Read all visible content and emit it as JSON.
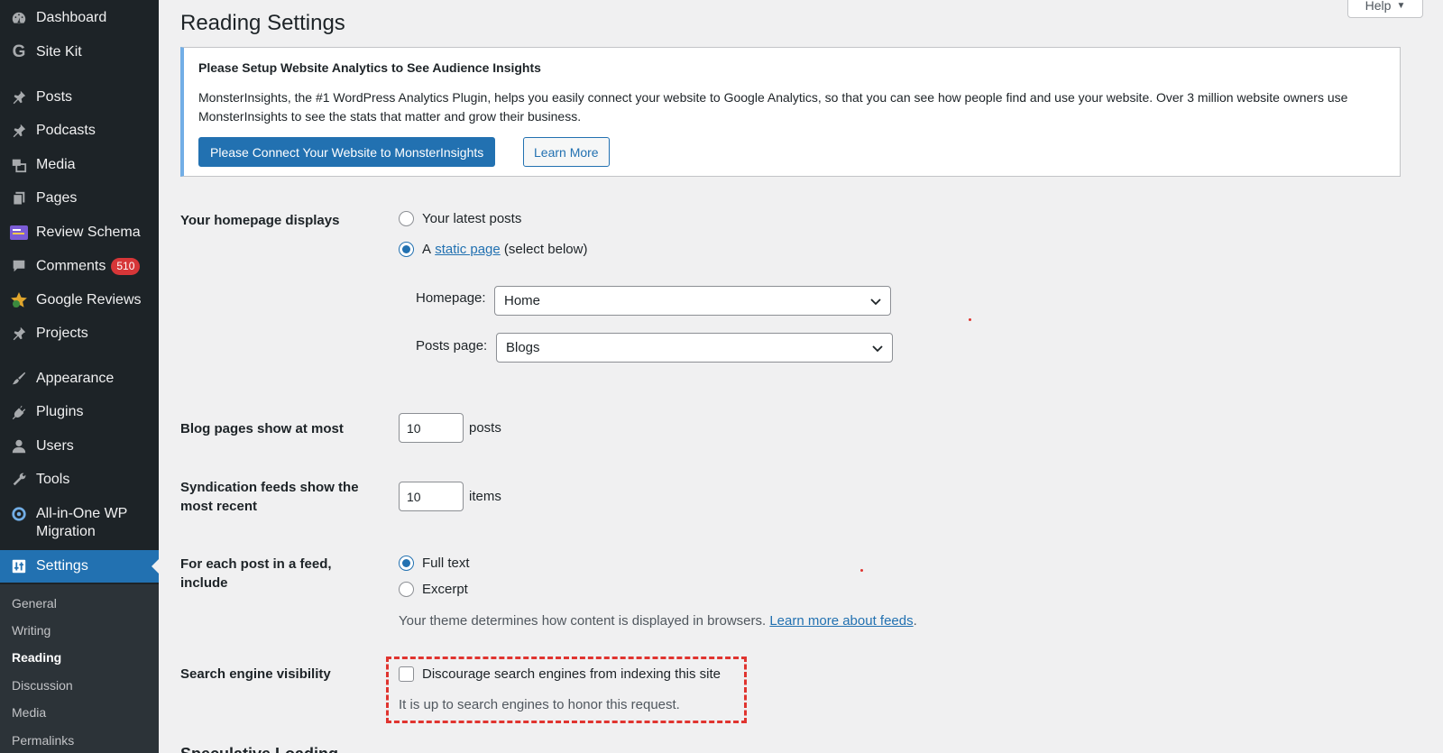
{
  "sidebar": {
    "items": [
      {
        "label": "Dashboard",
        "icon": "dashboard-icon"
      },
      {
        "label": "Site Kit",
        "icon": "google-g-icon"
      },
      {
        "label": "Posts",
        "icon": "pin-icon"
      },
      {
        "label": "Podcasts",
        "icon": "pin-icon"
      },
      {
        "label": "Media",
        "icon": "media-icon"
      },
      {
        "label": "Pages",
        "icon": "pages-icon"
      },
      {
        "label": "Review Schema",
        "icon": "review-schema-icon"
      },
      {
        "label": "Comments",
        "icon": "comment-icon",
        "badge": "510"
      },
      {
        "label": "Google Reviews",
        "icon": "star-icon"
      },
      {
        "label": "Projects",
        "icon": "pin-icon"
      },
      {
        "label": "Appearance",
        "icon": "brush-icon"
      },
      {
        "label": "Plugins",
        "icon": "plugin-icon"
      },
      {
        "label": "Users",
        "icon": "user-icon"
      },
      {
        "label": "Tools",
        "icon": "wrench-icon"
      },
      {
        "label": "All-in-One WP Migration",
        "icon": "migration-icon"
      },
      {
        "label": "Settings",
        "icon": "settings-icon",
        "active": true
      }
    ],
    "submenu": [
      "General",
      "Writing",
      "Reading",
      "Discussion",
      "Media",
      "Permalinks"
    ],
    "submenu_current": "Reading"
  },
  "header": {
    "title": "Reading Settings",
    "help_label": "Help"
  },
  "notice": {
    "heading": "Please Setup Website Analytics to See Audience Insights",
    "body": "MonsterInsights, the #1 WordPress Analytics Plugin, helps you easily connect your website to Google Analytics, so that you can see how people find and use your website. Over 3 million website owners use MonsterInsights to see the stats that matter and grow their business.",
    "primary_button": "Please Connect Your Website to MonsterInsights",
    "secondary_button": "Learn More"
  },
  "homepage": {
    "label": "Your homepage displays",
    "option_latest": "Your latest posts",
    "option_static_prefix": "A",
    "option_static_link": "static page",
    "option_static_suffix": "(select below)",
    "selected": "static",
    "homepage_label": "Homepage:",
    "homepage_value": "Home",
    "posts_page_label": "Posts page:",
    "posts_page_value": "Blogs"
  },
  "blog_pages": {
    "label": "Blog pages show at most",
    "value": "10",
    "unit": "posts"
  },
  "syndication": {
    "label_line1": "Syndication feeds show the",
    "label_line2": "most recent",
    "value": "10",
    "unit": "items"
  },
  "feed": {
    "label_line1": "For each post in a feed,",
    "label_line2": "include",
    "option_full": "Full text",
    "option_excerpt": "Excerpt",
    "selected": "full",
    "desc_text": "Your theme determines how content is displayed in browsers.",
    "desc_link": "Learn more about feeds",
    "desc_end": "."
  },
  "search_visibility": {
    "label": "Search engine visibility",
    "checkbox_label": "Discourage search engines from indexing this site",
    "checked": false,
    "desc": "It is up to search engines to honor this request."
  },
  "next_section": {
    "title": "Speculative Loading"
  },
  "colors": {
    "sidebar_bg": "#1d2327",
    "accent": "#2271b1",
    "badge": "#d63638",
    "highlight": "#e0342f"
  }
}
